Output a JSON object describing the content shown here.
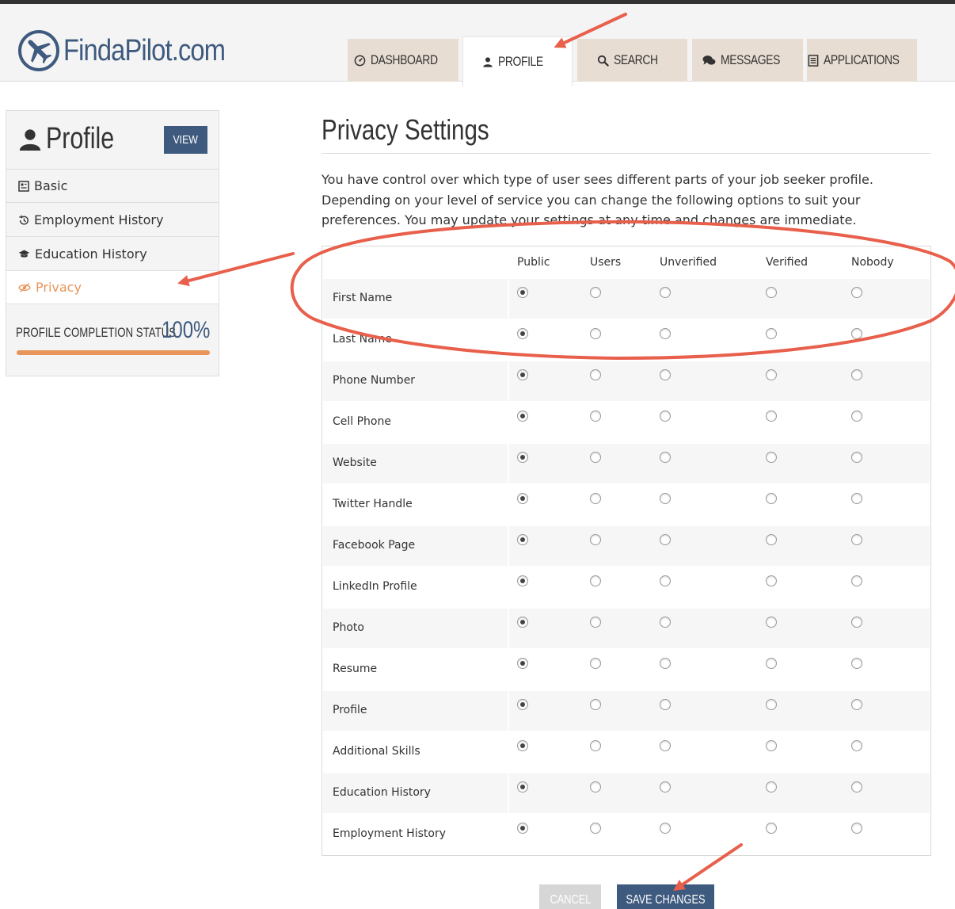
{
  "brand": {
    "name": "FindaPilot.com",
    "color": "#3e5a7e"
  },
  "nav": {
    "tabs": [
      {
        "label": "DASHBOARD",
        "icon": "dashboard-icon",
        "active": false
      },
      {
        "label": "PROFILE",
        "icon": "user-icon",
        "active": true
      },
      {
        "label": "SEARCH",
        "icon": "search-icon",
        "active": false
      },
      {
        "label": "MESSAGES",
        "icon": "chat-icon",
        "active": false
      },
      {
        "label": "APPLICATIONS",
        "icon": "document-icon",
        "active": false
      }
    ]
  },
  "sidebar": {
    "title": "Profile",
    "view_label": "VIEW",
    "items": [
      {
        "label": "Basic",
        "icon": "id-card-icon",
        "active": false
      },
      {
        "label": "Employment History",
        "icon": "history-icon",
        "active": false
      },
      {
        "label": "Education History",
        "icon": "graduation-cap-icon",
        "active": false
      },
      {
        "label": "Privacy",
        "icon": "eye-slash-icon",
        "active": true
      }
    ],
    "status": {
      "label": "PROFILE COMPLETION STATUS",
      "value": "100%",
      "progress": 1.0
    },
    "accent": "#e9955a"
  },
  "main": {
    "title": "Privacy Settings",
    "description": "You have control over which type of user sees different parts of your job seeker profile. Depending on your level of service you can change the following options to suit your preferences. You may update your settings at any time and changes are immediate.",
    "columns": [
      "Public",
      "Users",
      "Unverified",
      "Verified",
      "Nobody"
    ],
    "rows": [
      {
        "label": "First Name",
        "selected": 0
      },
      {
        "label": "Last Name",
        "selected": 0
      },
      {
        "label": "Phone Number",
        "selected": 0
      },
      {
        "label": "Cell Phone",
        "selected": 0
      },
      {
        "label": "Website",
        "selected": 0
      },
      {
        "label": "Twitter Handle",
        "selected": 0
      },
      {
        "label": "Facebook Page",
        "selected": 0
      },
      {
        "label": "LinkedIn Profile",
        "selected": 0
      },
      {
        "label": "Photo",
        "selected": 0
      },
      {
        "label": "Resume",
        "selected": 0
      },
      {
        "label": "Profile",
        "selected": 0
      },
      {
        "label": "Additional Skills",
        "selected": 0
      },
      {
        "label": "Education History",
        "selected": 0
      },
      {
        "label": "Employment History",
        "selected": 0
      }
    ]
  },
  "actions": {
    "cancel_label": "CANCEL",
    "save_label": "SAVE CHANGES"
  },
  "annotation_color": "#e8604c"
}
